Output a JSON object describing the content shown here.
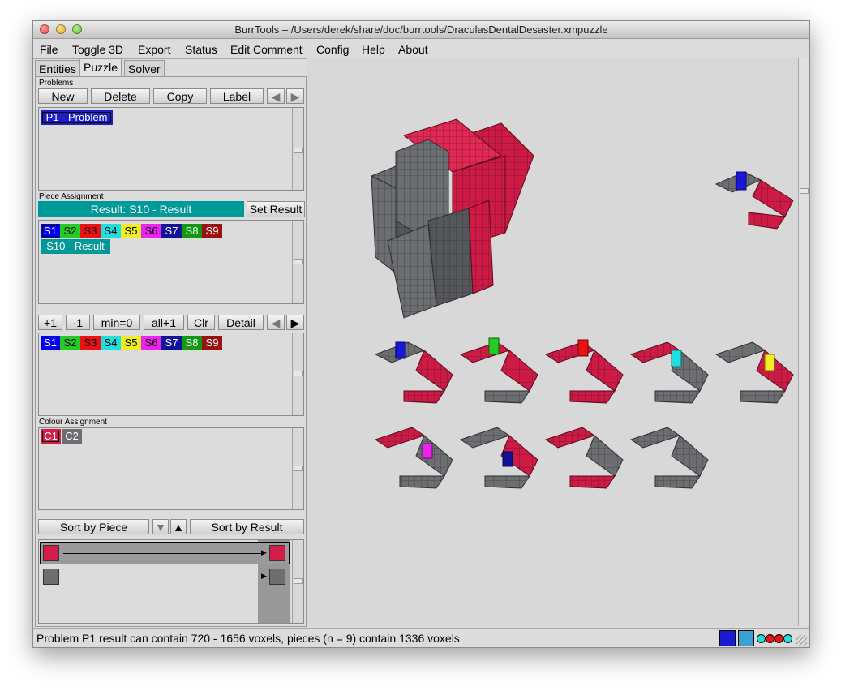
{
  "window": {
    "title": "BurrTools – /Users/derek/share/doc/burrtools/DraculasDentalDesaster.xmpuzzle"
  },
  "menu": [
    "File",
    "Toggle 3D",
    "Export",
    "Status",
    "Edit Comment",
    "Config",
    "Help",
    "About"
  ],
  "tabs": [
    "Entities",
    "Puzzle",
    "Solver"
  ],
  "problems": {
    "heading": "Problems",
    "buttons": {
      "new": "New",
      "delete": "Delete",
      "copy": "Copy",
      "label": "Label"
    },
    "items": [
      "P1 - Problem"
    ]
  },
  "piece_assignment": {
    "heading": "Piece Assignment",
    "result_label": "Result: S10 - Result",
    "set_result": "Set Result",
    "shapes": [
      "S1",
      "S2",
      "S3",
      "S4",
      "S5",
      "S6",
      "S7",
      "S8",
      "S9"
    ],
    "result_item": "S10 - Result"
  },
  "counts": {
    "buttons": {
      "plus1": "+1",
      "minus1": "-1",
      "min0": "min=0",
      "all1": "all+1",
      "clr": "Clr",
      "detail": "Detail"
    },
    "shapes": [
      "S1",
      "S2",
      "S3",
      "S4",
      "S5",
      "S6",
      "S7",
      "S8",
      "S9"
    ]
  },
  "colour_assignment": {
    "heading": "Colour Assignment",
    "colours": [
      "C1",
      "C2"
    ]
  },
  "sort": {
    "by_piece": "Sort by Piece",
    "by_result": "Sort by Result"
  },
  "status_text": "Problem P1 result can contain 720 - 1656 voxels, pieces (n = 9) contain 1336 voxels",
  "colors": {
    "S1": "#0000ee",
    "S2": "#22cc22",
    "S3": "#ee1111",
    "S4": "#22dddd",
    "S5": "#eeee22",
    "S6": "#ee22ee",
    "S7": "#111199",
    "S8": "#119911",
    "S9": "#991111",
    "C1": "#d41c48",
    "C2": "#6e6e72",
    "result": "#009999",
    "selection": "#1e1ec8"
  }
}
